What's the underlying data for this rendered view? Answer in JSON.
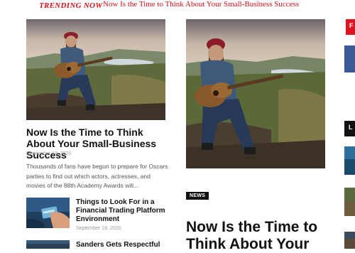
{
  "ticker": {
    "label": "TRENDING NOW",
    "headline": "Now Is the Time to Think About Your Small-Business Success"
  },
  "featured": {
    "title": "Now Is the Time to Think About Your Small-Business Success",
    "date": "September 18, 2020",
    "excerpt": "Thousands of fans have begun to prepare for Oscars parties to find out which actors, actresses, and movies of the 88th Academy Awards will..."
  },
  "list": [
    {
      "title": "Things to Look For in a Financial Trading Platform Environment",
      "date": "September 18, 2020"
    },
    {
      "title": "Sanders Gets Respectful"
    }
  ],
  "second": {
    "badge": "NEWS",
    "title": "Now Is the Time to Think About Your"
  },
  "side": {
    "red_tag_letter": "F",
    "black_tag_letter": "L"
  },
  "colors": {
    "accent": "#d0101a",
    "badge_bg": "#111111",
    "link_blue": "#3b5998"
  }
}
